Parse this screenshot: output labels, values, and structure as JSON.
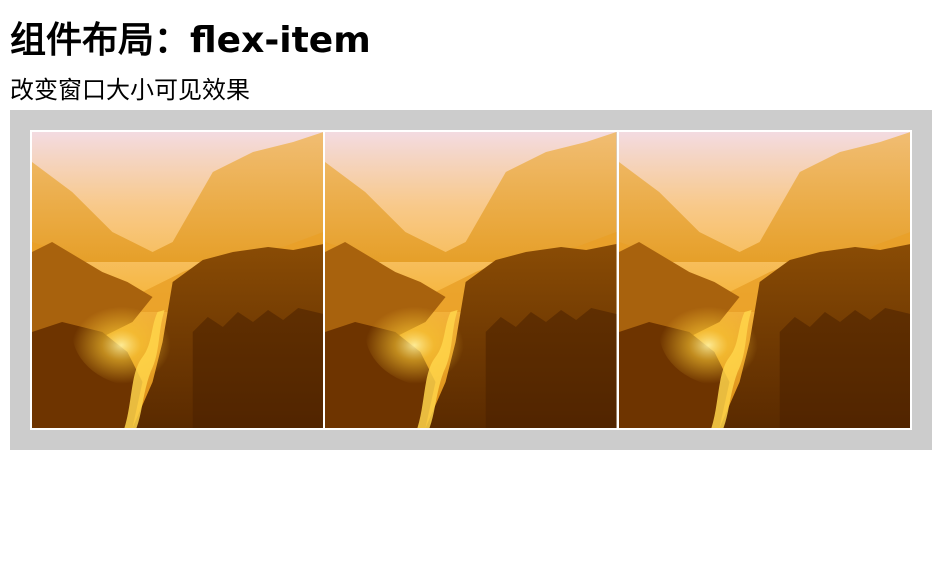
{
  "page": {
    "title": "组件布局：flex-item",
    "subtitle": "改变窗口大小可见效果"
  },
  "flex_container": {
    "background": "#cccccc",
    "items": [
      {
        "image": "golden-forest-valley-image"
      },
      {
        "image": "golden-forest-valley-image"
      },
      {
        "image": "golden-forest-valley-image"
      }
    ]
  },
  "colors": {
    "sky": "#f3dbe1",
    "haze": "#f6b740",
    "glow": "#f7c431",
    "forest_dark": "#5a2a00"
  }
}
